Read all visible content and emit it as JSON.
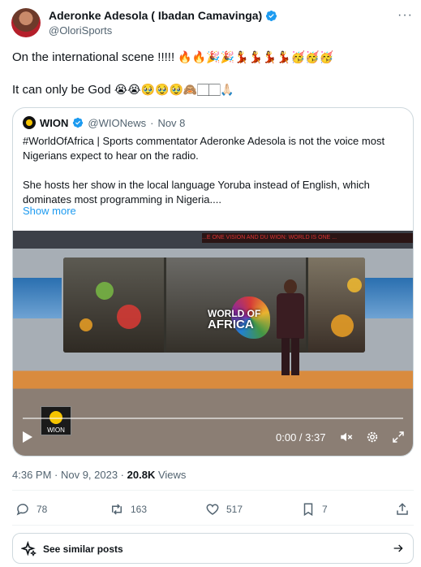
{
  "author": {
    "name": "Aderonke Adesola ( Ibadan Camavinga)",
    "handle": "@OloriSports",
    "avatar_icon": "profile-photo",
    "verified_icon": "verified-badge-icon"
  },
  "more_label": "···",
  "tweet": {
    "line1": "On the international scene !!!!!",
    "line1_emojis": "🔥🔥🎉🎉💃💃💃💃🥳🥳🥳",
    "line2": "It can only be God",
    "line2_emojis": "😭😭🥹🥹🥹🙈🏻🏻🙏🏻"
  },
  "quote": {
    "name": "WION",
    "handle": "@WIONews",
    "date": "Nov 8",
    "separator": "·",
    "text_p1": "#WorldOfAfrica | Sports commentator Aderonke Adesola is not the voice most Nigerians expect to hear on the radio.",
    "text_p2": "She hosts her show in the local language Yoruba instead of English, which dominates most programming in Nigeria....",
    "show_more": "Show more"
  },
  "video": {
    "ticker": "...E ONE VISION AND DU   WION: WORLD IS ONE  ...",
    "overlay_title_1": "WORLD OF",
    "overlay_title_2": "AFRICA",
    "badge": "WION",
    "time": "0:00 / 3:37",
    "progress": 0.0
  },
  "meta": {
    "timestamp": "4:36 PM · Nov 9, 2023 ·",
    "views_count": "20.8K",
    "views_label": "Views"
  },
  "actions": {
    "replies": "78",
    "reposts": "163",
    "likes": "517",
    "bookmarks": "7"
  },
  "similar": {
    "label": "See similar posts"
  },
  "colors": {
    "accent": "#1d9bf0",
    "text": "#0f1419",
    "muted": "#536471",
    "border": "#cfd9de"
  }
}
